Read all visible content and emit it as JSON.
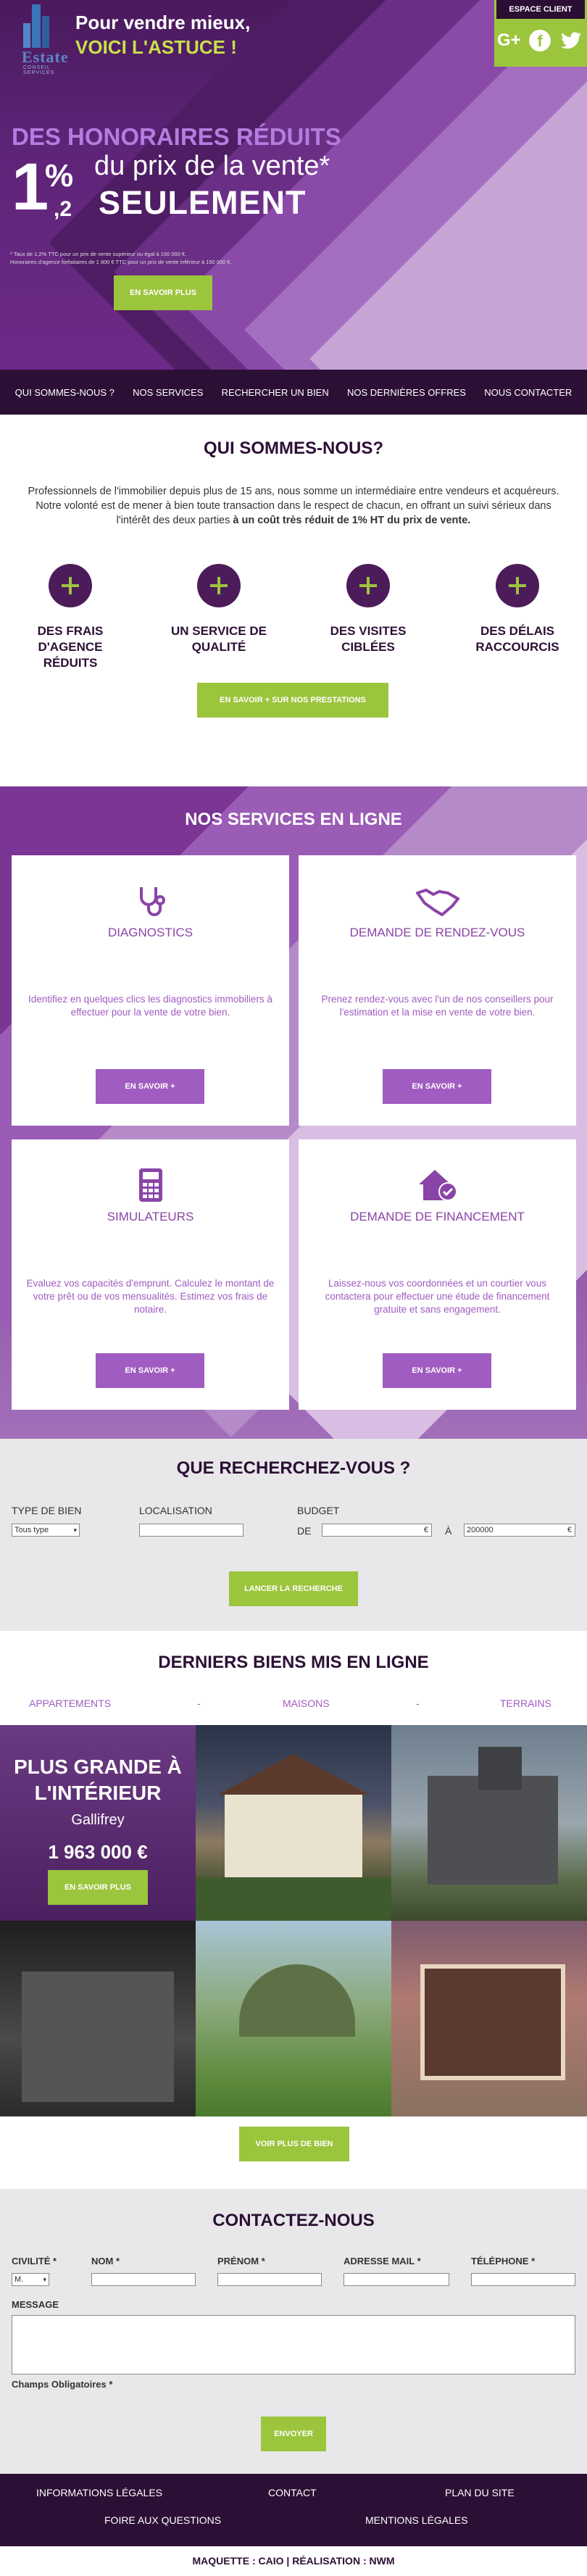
{
  "brand": {
    "logo_word": "Estate",
    "logo_sub": "CONSEIL SERVICES",
    "tagline_1": "Pour vendre mieux,",
    "tagline_2": "VOICI L'ASTUCE !"
  },
  "client": {
    "label": "ESPACE CLIENT",
    "social": [
      "google-plus-icon",
      "facebook-icon",
      "twitter-icon"
    ]
  },
  "hero": {
    "headline": "DES HONORAIRES RÉDUITS",
    "big_digit": "1",
    "percent": "%",
    "decimal": ",2",
    "line2": "du prix de la vente*",
    "line3": "SEULEMENT",
    "footnote_1": "* Taux de 1,2% TTC pour un prix de vente supérieur ou égal à 150 000 €.",
    "footnote_2": "Honoraires d'agence forfaitaires de 1 800 € TTC pour un prix de vente inférieur à 150 000 €.",
    "button": "EN SAVOIR PLUS"
  },
  "nav": [
    "QUI SOMMES-NOUS ?",
    "NOS SERVICES",
    "RECHERCHER UN BIEN",
    "NOS DERNIÈRES OFFRES",
    "NOUS CONTACTER"
  ],
  "qui": {
    "title": "QUI SOMMES-NOUS?",
    "text_1": "Professionnels de l'immobilier depuis plus de 15 ans, nous somme un intermédiaire entre vendeurs et acquéreurs.",
    "text_2": "Notre volonté est de mener à bien toute transaction dans le respect de chacun, en offrant un suivi sérieux dans l'intérêt des deux parties",
    "text_bold": "à un coût très réduit de 1% HT du prix de vente.",
    "features": [
      "DES FRAIS D'AGENCE RÉDUITS",
      "UN SERVICE DE QUALITÉ",
      "DES VISITES CIBLÉES",
      "DES DÉLAIS RACCOURCIS"
    ],
    "button": "EN SAVOIR + SUR NOS PRESTATIONS"
  },
  "services": {
    "title": "NOS SERVICES EN LIGNE",
    "cards": [
      {
        "title": "DIAGNOSTICS",
        "icon": "stethoscope-icon",
        "text": "Identifiez en quelques clics les diagnostics immobiliers à effectuer pour la vente de votre bien.",
        "button": "EN SAVOIR +"
      },
      {
        "title": "DEMANDE DE RENDEZ-VOUS",
        "icon": "handshake-icon",
        "text": "Prenez rendez-vous avec l'un de nos conseillers pour l'estimation et la mise en vente de votre bien.",
        "button": "EN SAVOIR +"
      },
      {
        "title": "SIMULATEURS",
        "icon": "calculator-icon",
        "text": "Evaluez vos capacités d'emprunt. Calculez le montant de votre prêt ou de vos mensualités. Estimez vos frais de notaire.",
        "button": "EN SAVOIR +"
      },
      {
        "title": "DEMANDE DE FINANCEMENT",
        "icon": "house-check-icon",
        "text": "Laissez-nous vos coordonnées et un courtier vous contactera pour effectuer une étude de financement gratuite et sans engagement.",
        "button": "EN SAVOIR +"
      }
    ]
  },
  "search": {
    "title": "QUE RECHERCHEZ-VOUS ?",
    "type_label": "TYPE DE BIEN",
    "type_value": "Tous type",
    "loc_label": "LOCALISATION",
    "loc_value": "",
    "budget_label": "BUDGET",
    "de_label": "DE",
    "de_value": "",
    "currency": "€",
    "a_label": "À",
    "a_value": "200000",
    "button": "LANCER LA RECHERCHE"
  },
  "biens": {
    "title": "DERNIERS BIENS MIS EN LIGNE",
    "categories": [
      "APPARTEMENTS",
      "MAISONS",
      "TERRAINS"
    ],
    "separator": "-",
    "featured": {
      "title": "PLUS GRANDE À L'INTÉRIEUR",
      "city": "Gallifrey",
      "price": "1 963 000 €",
      "button": "EN SAVOIR PLUS"
    },
    "button": "VOIR PLUS DE BIEN"
  },
  "contact": {
    "title": "CONTACTEZ-NOUS",
    "civ_label": "CIVILITÉ *",
    "civ_value": "M.",
    "nom_label": "NOM *",
    "prenom_label": "PRÉNOM *",
    "mail_label": "ADRESSE MAIL *",
    "tel_label": "TÉLÉPHONE *",
    "msg_label": "MESSAGE",
    "required_note": "Champs Obligatoires *",
    "button": "ENVOYER"
  },
  "footer": {
    "links": [
      "INFORMATIONS LÉGALES",
      "CONTACT",
      "PLAN DU SITE",
      "FOIRE AUX QUESTIONS",
      "MENTIONS LÉGALES"
    ],
    "credit": "MAQUETTE : CAIO | RÉALISATION : NWM"
  },
  "colors": {
    "purple_dark": "#2c0f35",
    "purple": "#8a44a7",
    "green": "#9bc53d"
  }
}
